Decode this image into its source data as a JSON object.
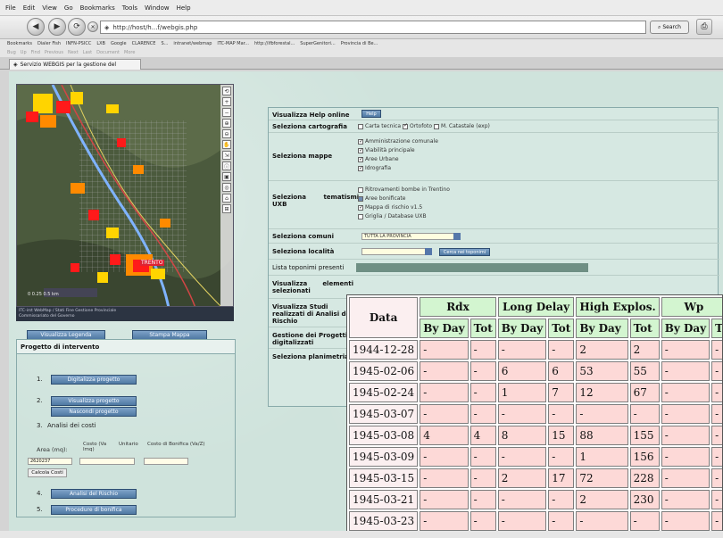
{
  "browser": {
    "menu": [
      "File",
      "Edit",
      "View",
      "Go",
      "Bookmarks",
      "Tools",
      "Window",
      "Help"
    ],
    "url": "http://host/h...f/webgis.php",
    "search_label": "Search",
    "bookmarks": [
      "Bookmarks",
      "Dialer Fish",
      "INFN-PSICC",
      "LXB",
      "Google",
      "CLARENCE",
      "S...",
      "intranet/webmap",
      "ITC-MAP Mar...",
      "http://ifbforestal...",
      "SuperGenitori...",
      "Provincia di Be..."
    ],
    "personal_toolbar": [
      "Bug",
      "Up",
      "Find",
      "Previous",
      "Next",
      "Last",
      "Document",
      "More"
    ],
    "tab_label": "Servizio WEBGIS per la gestione del"
  },
  "map": {
    "caption_line1": "ITC-irst WebMap / Stati Fine Gestione Provinciale",
    "caption_line2": "Commissariato del Governo",
    "scale_text": "0   0.25   0.5  km",
    "label": "TRENTO",
    "tools": [
      "⟲",
      "+",
      "−",
      "⊕",
      "⊖",
      "✋",
      "⇲",
      "ⓘ",
      "▣",
      "◎",
      "⌂",
      "⊞"
    ]
  },
  "left_buttons": {
    "legend": "Visualizza Legenda",
    "print": "Stampa Mappa"
  },
  "progetto": {
    "title": "Progetto di intervento",
    "step1_btn": "Digitalizza progetto",
    "step2_btn_a": "Visualizza progetto",
    "step2_btn_b": "Nascondi progetto",
    "step3_label": "Analisi dei costi",
    "area_label": "Area (mq):",
    "head_costo": "Costo (Va Imq)",
    "head_unitario": "Unitario",
    "head_bonifica": "Costo di Bonifica (Va/Z)",
    "area_value": "2620237",
    "calc_btn": "Calcola Costi",
    "step4_btn": "Analisi del Rischio",
    "step5_btn": "Procedure di bonifica",
    "nums": [
      "1.",
      "2.",
      "3.",
      "4.",
      "5."
    ]
  },
  "form": {
    "help_label": "Visualizza Help online",
    "help_btn": "Help",
    "carto_label": "Seleziona cartografia",
    "carto_opts": [
      "Carta tecnica",
      "Ortofoto",
      "M. Catastale (exp)"
    ],
    "mappe_label": "Seleziona mappe",
    "mappe_opts": [
      "Amministrazione comunale",
      "Viabilità principale",
      "Aree Urbane",
      "Idrografia"
    ],
    "tematismi_label_a": "Seleziona",
    "tematismi_label_b": "tematismi",
    "tematismi_label_c": "UXB",
    "tematismi_opts": [
      "Ritrovamenti bombe in Trentino",
      "Aree bonificate",
      "Mappa di rischio v1.5",
      "Griglia / Database UXB"
    ],
    "comuni_label": "Seleziona comuni",
    "comuni_value": "TUTTA LA PROVINCIA",
    "localita_label": "Seleziona località",
    "localita_btn": "Cerca nei toponimi",
    "toponimi_label": "Lista toponimi presenti",
    "visualizza_label_a": "Visualizza",
    "visualizza_label_b": "elementi",
    "visualizza_label_c": "selezionati",
    "studi_label_a": "Visualizza Studi",
    "studi_label_b": "realizzati di Analisi del",
    "studi_label_c": "Rischio",
    "gestione_label_a": "Gestione dei Progetti",
    "gestione_label_b": "digitalizzati",
    "planimetria_label": "Seleziona planimetria"
  },
  "overlay_table": {
    "date_header": "Data",
    "groups": [
      "Rdx",
      "Long Delay",
      "High Explos.",
      "Wp"
    ],
    "sub": [
      "By Day",
      "Tot",
      "By Day",
      "Tot",
      "By Day",
      "Tot",
      "By Day",
      "T"
    ],
    "rows": [
      {
        "date": "1944-12-28",
        "cells": [
          "-",
          "-",
          "-",
          "-",
          "2",
          "2",
          "-",
          "-"
        ]
      },
      {
        "date": "1945-02-06",
        "cells": [
          "-",
          "-",
          "6",
          "6",
          "53",
          "55",
          "-",
          "-"
        ]
      },
      {
        "date": "1945-02-24",
        "cells": [
          "-",
          "-",
          "1",
          "7",
          "12",
          "67",
          "-",
          "-"
        ]
      },
      {
        "date": "1945-03-07",
        "cells": [
          "-",
          "-",
          "-",
          "-",
          "-",
          "-",
          "-",
          "-"
        ]
      },
      {
        "date": "1945-03-08",
        "cells": [
          "4",
          "4",
          "8",
          "15",
          "88",
          "155",
          "-",
          "-"
        ]
      },
      {
        "date": "1945-03-09",
        "cells": [
          "-",
          "-",
          "-",
          "-",
          "1",
          "156",
          "-",
          "-"
        ]
      },
      {
        "date": "1945-03-15",
        "cells": [
          "-",
          "-",
          "2",
          "17",
          "72",
          "228",
          "-",
          "-"
        ]
      },
      {
        "date": "1945-03-21",
        "cells": [
          "-",
          "-",
          "-",
          "-",
          "2",
          "230",
          "-",
          "-"
        ]
      },
      {
        "date": "1945-03-23",
        "cells": [
          "-",
          "-",
          "-",
          "-",
          "-",
          "-",
          "-",
          "-"
        ]
      }
    ]
  }
}
